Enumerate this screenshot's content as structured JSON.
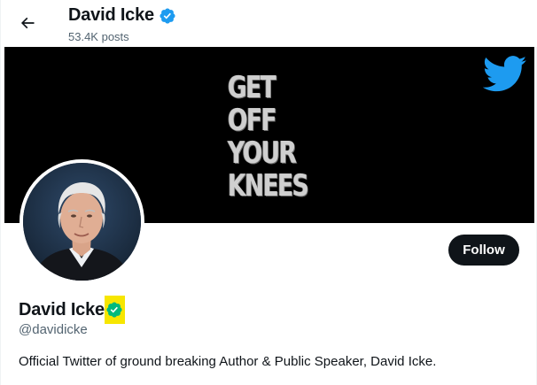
{
  "header": {
    "name": "David Icke",
    "posts_count": "53.4K posts"
  },
  "banner": {
    "lines": [
      "GET",
      "OFF",
      "YOUR",
      "KNEES"
    ]
  },
  "profile": {
    "name": "David Icke",
    "handle": "@davidicke",
    "bio": "Official Twitter of ground breaking Author & Public Speaker, David Icke."
  },
  "actions": {
    "follow_label": "Follow"
  },
  "icons": {
    "back": "arrow-left-icon",
    "verified": "verified-badge-icon",
    "brand": "twitter-bird-icon"
  },
  "colors": {
    "verified_blue": "#1d9bf0",
    "verified_green": "#00ba7c",
    "highlight_yellow": "#f7e600",
    "twitter_blue": "#1d9bf0",
    "text_primary": "#0f1419",
    "text_secondary": "#536471"
  }
}
